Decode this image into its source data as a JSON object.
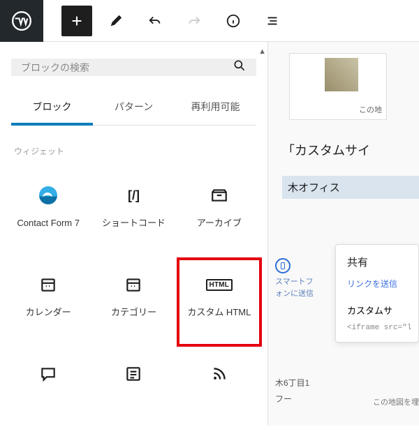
{
  "topbar": {
    "icons": {
      "wp": "wordpress-logo",
      "add": "plus-icon",
      "edit": "pencil-icon",
      "undo": "undo-icon",
      "redo": "redo-icon",
      "info": "info-icon",
      "outline": "list-view-icon"
    }
  },
  "search": {
    "placeholder": "ブロックの検索"
  },
  "tabs": {
    "items": [
      "ブロック",
      "パターン",
      "再利用可能"
    ],
    "activeIndex": 0
  },
  "section": {
    "title": "ウィジェット"
  },
  "blocks": [
    {
      "icon": "contact-form-7-icon",
      "label": "Contact Form 7"
    },
    {
      "icon": "shortcode-icon",
      "label": "ショートコード"
    },
    {
      "icon": "archive-icon",
      "label": "アーカイブ"
    },
    {
      "icon": "calendar-icon",
      "label": "カレンダー"
    },
    {
      "icon": "calendar-icon",
      "label": "カテゴリー"
    },
    {
      "icon": "html-icon",
      "label": "カスタム HTML",
      "badge": "HTML",
      "highlight": true
    },
    {
      "icon": "comment-icon",
      "label": ""
    },
    {
      "icon": "latest-posts-icon",
      "label": ""
    },
    {
      "icon": "rss-icon",
      "label": ""
    }
  ],
  "preview": {
    "map_caption": "この地",
    "heading": "「カスタムサイ",
    "bar": "木オフィス",
    "popup": {
      "title": "共有",
      "link": "リンクを送信",
      "section": "カスタムサ",
      "code": "<iframe src=\"l"
    },
    "left_hint_line1": "スマートフ",
    "left_hint_line2": "ォンに送信",
    "addr_line1": "木6丁目1",
    "addr_line2": "フー",
    "map_footer": "この地図を埋"
  }
}
